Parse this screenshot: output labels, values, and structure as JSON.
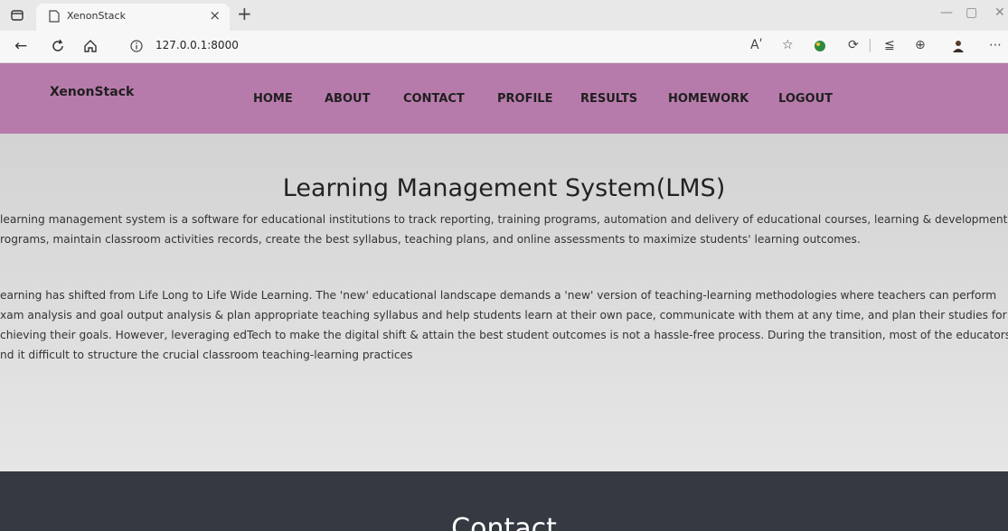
{
  "browser": {
    "tab_title": "XenonStack",
    "tab_close": "×",
    "new_tab": "+",
    "url": "127.0.0.1:8000",
    "icons": [
      "tab-actions-icon",
      "page-icon",
      "back-icon",
      "refresh-icon",
      "home-icon",
      "info-icon",
      "read-aloud-icon",
      "favorite-icon",
      "extension-icon",
      "extensions-puzzle-icon",
      "favorites-icon",
      "collections-icon",
      "profile-icon",
      "menu-icon"
    ],
    "read_aloud": "Aʹ",
    "menu": "⋯"
  },
  "site": {
    "brand": "XenonStack",
    "nav": [
      "HOME",
      "ABOUT",
      "CONTACT",
      "PROFILE",
      "RESULTS",
      "HOMEWORK",
      "LOGOUT"
    ],
    "accent_color": "#b77bab",
    "dark_color": "#353941"
  },
  "hero": {
    "title": "Learning Management System(LMS)",
    "para1": [
      " learning management system is a software for educational institutions to track reporting, training programs, automation and delivery of educational courses, learning & development",
      "rograms, maintain classroom activities records, create the best syllabus, teaching plans, and online assessments to maximize students' learning outcomes."
    ],
    "para2": [
      "earning has shifted from Life Long to Life Wide Learning. The 'new' educational landscape demands a 'new' version of teaching-learning methodologies where teachers can perform",
      "xam analysis and goal output analysis & plan appropriate teaching syllabus and help students learn at their own pace, communicate with them at any time, and plan their studies for",
      "chieving their goals. However, leveraging edTech to make the digital shift & attain the best student outcomes is not a hassle-free process. During the transition, most of the educators",
      "nd it difficult to structure the crucial classroom teaching-learning practices"
    ]
  },
  "section": {
    "title": "Contact"
  }
}
